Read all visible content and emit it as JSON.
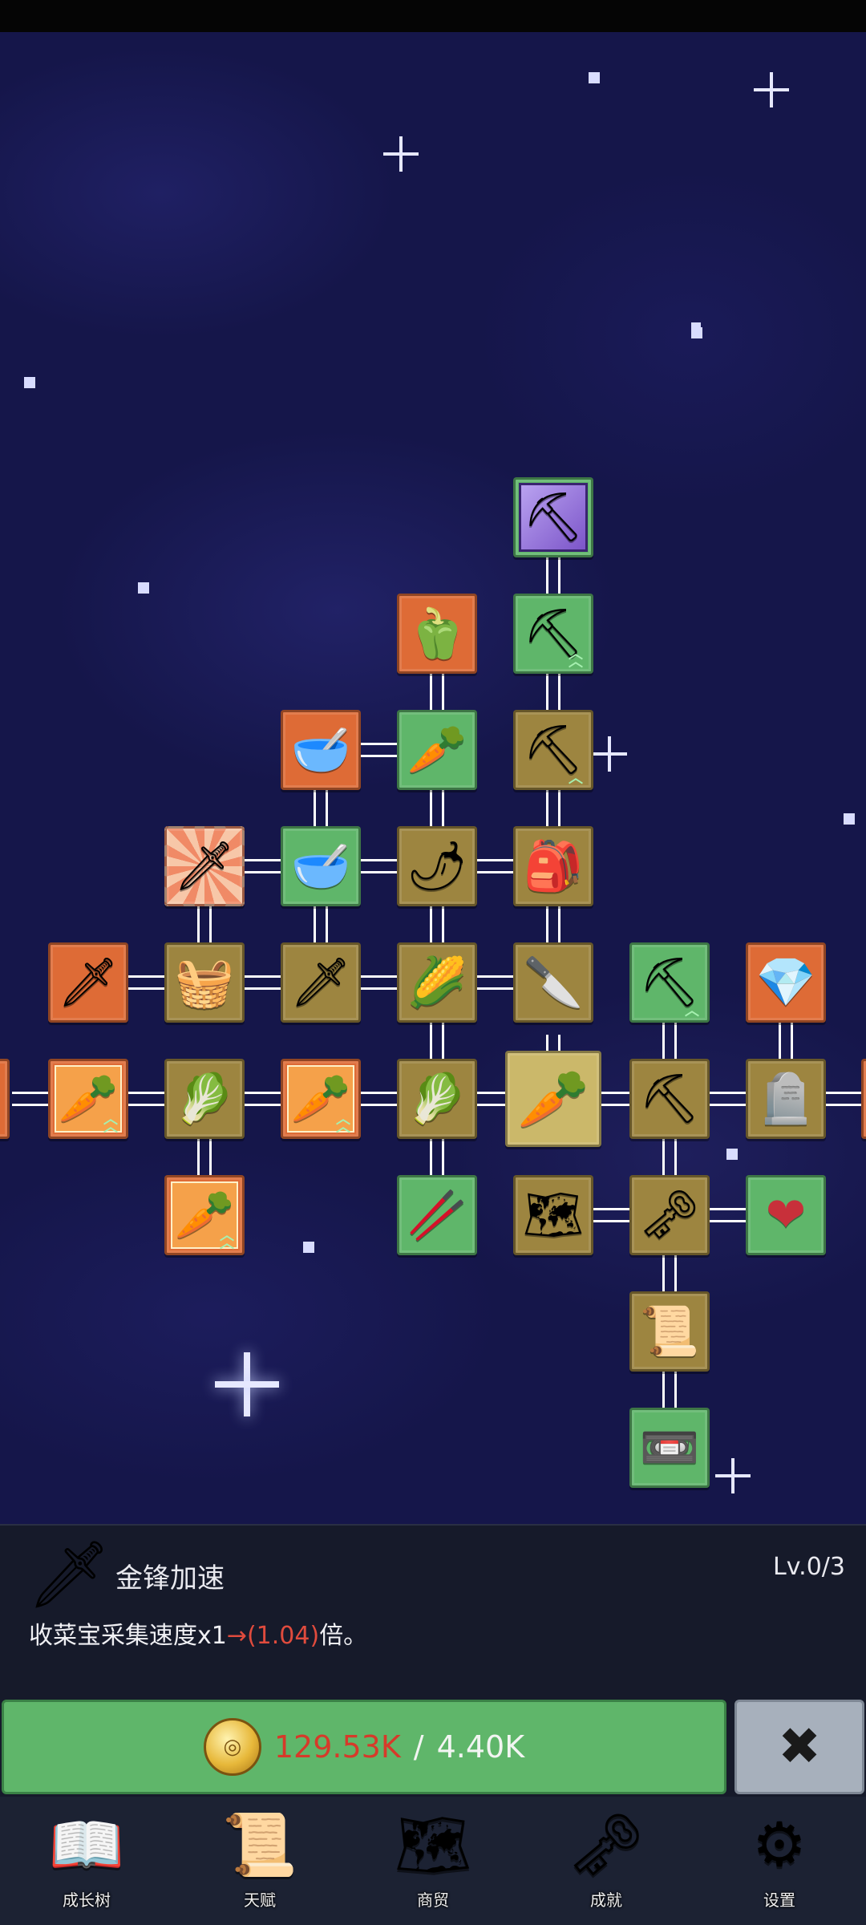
{
  "colors": {
    "green": "#5fb66a",
    "orange": "#de6b36",
    "gold": "#9d8540",
    "price_have": "#d63a2a",
    "highlight_red": "#e04b3d"
  },
  "tree": {
    "nodes": [
      {
        "icon": "shovel-icon",
        "glyph": "⛏",
        "color": "purple"
      },
      {
        "icon": "shovel-icon",
        "glyph": "⛏",
        "color": "green"
      },
      {
        "icon": "bell-pepper-icon",
        "glyph": "🫑",
        "color": "orange"
      },
      {
        "icon": "pot-icon",
        "glyph": "🥣",
        "color": "orange"
      },
      {
        "icon": "daikon-icon",
        "glyph": "🥕",
        "color": "green"
      },
      {
        "icon": "shovel-icon",
        "glyph": "⛏",
        "color": "gold"
      },
      {
        "icon": "golden-sword-icon",
        "glyph": "🗡",
        "color": "burst"
      },
      {
        "icon": "pot-icon",
        "glyph": "🥣",
        "color": "green"
      },
      {
        "icon": "chili-icon",
        "glyph": "🌶",
        "color": "gold"
      },
      {
        "icon": "backpack-icon",
        "glyph": "🎒",
        "color": "gold"
      },
      {
        "icon": "sword-icon",
        "glyph": "🗡",
        "color": "orange"
      },
      {
        "icon": "crate-icon",
        "glyph": "🧺",
        "color": "gold"
      },
      {
        "icon": "sword-icon",
        "glyph": "🗡",
        "color": "gold"
      },
      {
        "icon": "corn-icon",
        "glyph": "🌽",
        "color": "gold"
      },
      {
        "icon": "knife-icon",
        "glyph": "🔪",
        "color": "gold"
      },
      {
        "icon": "pickaxe-icon",
        "glyph": "⛏",
        "color": "green"
      },
      {
        "icon": "crystal-icon",
        "glyph": "💎",
        "color": "orange"
      },
      {
        "icon": "carrot-icon",
        "glyph": "🥕",
        "color": "orange"
      },
      {
        "icon": "cabbage-icon",
        "glyph": "🥬",
        "color": "gold"
      },
      {
        "icon": "carrot-icon",
        "glyph": "🥕",
        "color": "orange"
      },
      {
        "icon": "cabbage-icon",
        "glyph": "🥬",
        "color": "gold"
      },
      {
        "icon": "carrot-icon",
        "glyph": "🥕",
        "color": "lightgold"
      },
      {
        "icon": "pickaxe-icon",
        "glyph": "⛏",
        "color": "gold"
      },
      {
        "icon": "tombstone-icon",
        "glyph": "🪦",
        "color": "gold"
      },
      {
        "icon": "carrot-icon",
        "glyph": "🥕",
        "color": "orange"
      },
      {
        "icon": "leek-icon",
        "glyph": "🥢",
        "color": "green"
      },
      {
        "icon": "map-icon",
        "glyph": "🗺",
        "color": "gold"
      },
      {
        "icon": "key-icon",
        "glyph": "🗝",
        "color": "gold"
      },
      {
        "icon": "heart-icon",
        "glyph": "❤",
        "color": "green"
      },
      {
        "icon": "scroll-icon",
        "glyph": "📜",
        "color": "gold"
      },
      {
        "icon": "cassette-icon",
        "glyph": "📼",
        "color": "green"
      }
    ]
  },
  "info": {
    "icon": "golden-sword-icon",
    "glyph": "🗡",
    "title": "金锋加速",
    "level": "Lv.0/3",
    "desc_prefix": "收菜宝采集速度x1",
    "desc_arrow": "→(1.04)",
    "desc_suffix": "倍。"
  },
  "action": {
    "coin_icon": "coin-icon",
    "have": "129.53K",
    "separator": " / ",
    "need": "4.40K",
    "close_glyph": "✖"
  },
  "nav": [
    {
      "label": "成长树",
      "icon": "book-icon",
      "glyph": "📖"
    },
    {
      "label": "天赋",
      "icon": "scroll-icon",
      "glyph": "📜"
    },
    {
      "label": "商贸",
      "icon": "map-icon",
      "glyph": "🗺"
    },
    {
      "label": "成就",
      "icon": "key-icon",
      "glyph": "🗝"
    },
    {
      "label": "设置",
      "icon": "gear-icon",
      "glyph": "⚙"
    }
  ]
}
